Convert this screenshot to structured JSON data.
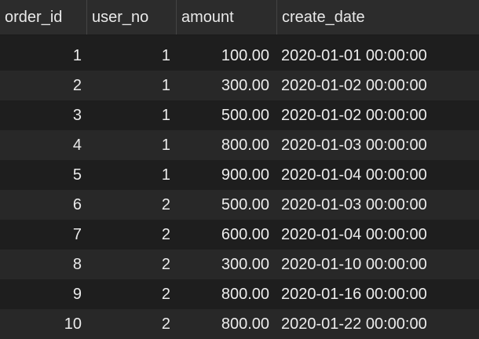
{
  "table": {
    "columns": [
      "order_id",
      "user_no",
      "amount",
      "create_date"
    ],
    "rows": [
      [
        "1",
        "1",
        "100.00",
        "2020-01-01 00:00:00"
      ],
      [
        "2",
        "1",
        "300.00",
        "2020-01-02 00:00:00"
      ],
      [
        "3",
        "1",
        "500.00",
        "2020-01-02 00:00:00"
      ],
      [
        "4",
        "1",
        "800.00",
        "2020-01-03 00:00:00"
      ],
      [
        "5",
        "1",
        "900.00",
        "2020-01-04 00:00:00"
      ],
      [
        "6",
        "2",
        "500.00",
        "2020-01-03 00:00:00"
      ],
      [
        "7",
        "2",
        "600.00",
        "2020-01-04 00:00:00"
      ],
      [
        "8",
        "2",
        "300.00",
        "2020-01-10 00:00:00"
      ],
      [
        "9",
        "2",
        "800.00",
        "2020-01-16 00:00:00"
      ],
      [
        "10",
        "2",
        "800.00",
        "2020-01-22 00:00:00"
      ]
    ]
  },
  "colors": {
    "background": "#1e1e1e",
    "header_background": "#2c2c2c",
    "alt_row_background": "#282828",
    "text": "#ececec"
  }
}
